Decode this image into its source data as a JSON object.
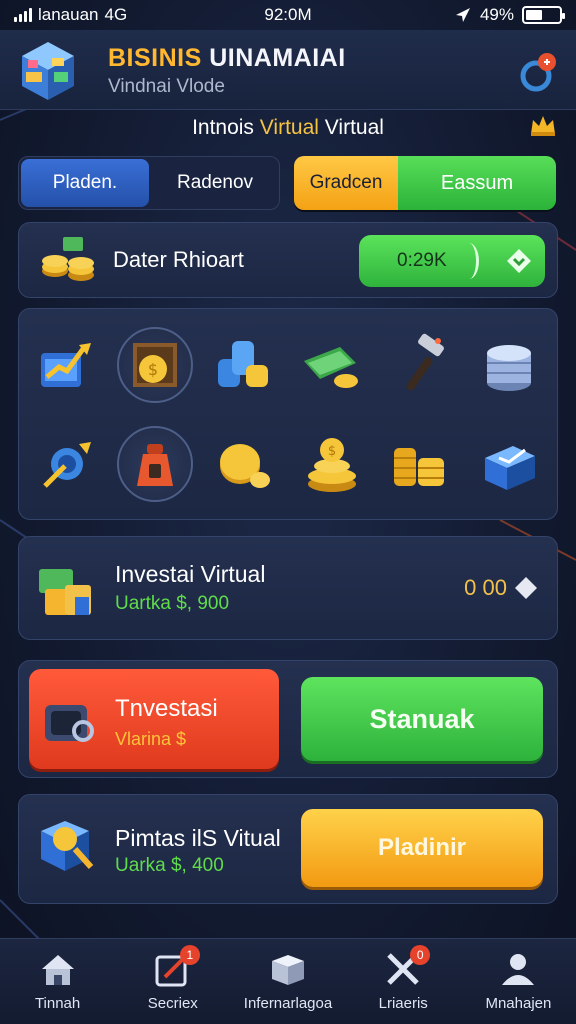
{
  "status_bar": {
    "carrier": "lanauan",
    "network": "4G",
    "time": "92:0M",
    "battery": "49%",
    "battery_level": 0.49
  },
  "header": {
    "title_part1": "BISINIS",
    "title_part2": "UINAMAIAI",
    "subtitle": "Vindnai Vlode"
  },
  "section": {
    "title_part1": "Intnois",
    "title_highlight": "Virtual",
    "title_part2": "Virtual"
  },
  "tabs": [
    {
      "label": "Pladen.",
      "active": true
    },
    {
      "label": "Radenov",
      "active": false
    }
  ],
  "toggle": {
    "left_label": "Gradcen",
    "right_label": "Eassum"
  },
  "balance": {
    "label": "Dater Rhioart",
    "value": "0:29K"
  },
  "assets": [
    {
      "icon": "chart-growth-icon"
    },
    {
      "icon": "coin-frame-icon"
    },
    {
      "icon": "coin-stack-blue-icon"
    },
    {
      "icon": "cash-bundle-icon"
    },
    {
      "icon": "hammer-icon"
    },
    {
      "icon": "silver-coins-icon"
    },
    {
      "icon": "target-arrow-icon"
    },
    {
      "icon": "money-bag-icon"
    },
    {
      "icon": "gold-coin-icon"
    },
    {
      "icon": "gold-coin-pile-icon"
    },
    {
      "icon": "gold-stacks-icon"
    },
    {
      "icon": "crate-icon"
    }
  ],
  "investment_row": {
    "title": "Investai Virtual",
    "value": "Uartka $, 900",
    "right_value": "0 00"
  },
  "invest_button": {
    "label": "Tnvestasi",
    "sub": "Vlarina $"
  },
  "green_button": {
    "label": "Stanuak"
  },
  "promo_row": {
    "title": "Pimtas ilS Vitual",
    "value": "Uarka $, 400"
  },
  "gold_button": {
    "label": "Pladinir"
  },
  "nav": [
    {
      "label": "Tinnah",
      "icon": "home-icon",
      "badge": ""
    },
    {
      "label": "Secriex",
      "icon": "edit-icon",
      "badge": "1"
    },
    {
      "label": "Infernarlagoa",
      "icon": "box-icon",
      "badge": ""
    },
    {
      "label": "Lriaeris",
      "icon": "tools-icon",
      "badge": "0"
    },
    {
      "label": "Mnahajen",
      "icon": "user-icon",
      "badge": ""
    }
  ],
  "colors": {
    "accent_gold": "#ffb830",
    "accent_green": "#3cc84a",
    "accent_red": "#f04a2a",
    "panel": "#1f2a46"
  }
}
